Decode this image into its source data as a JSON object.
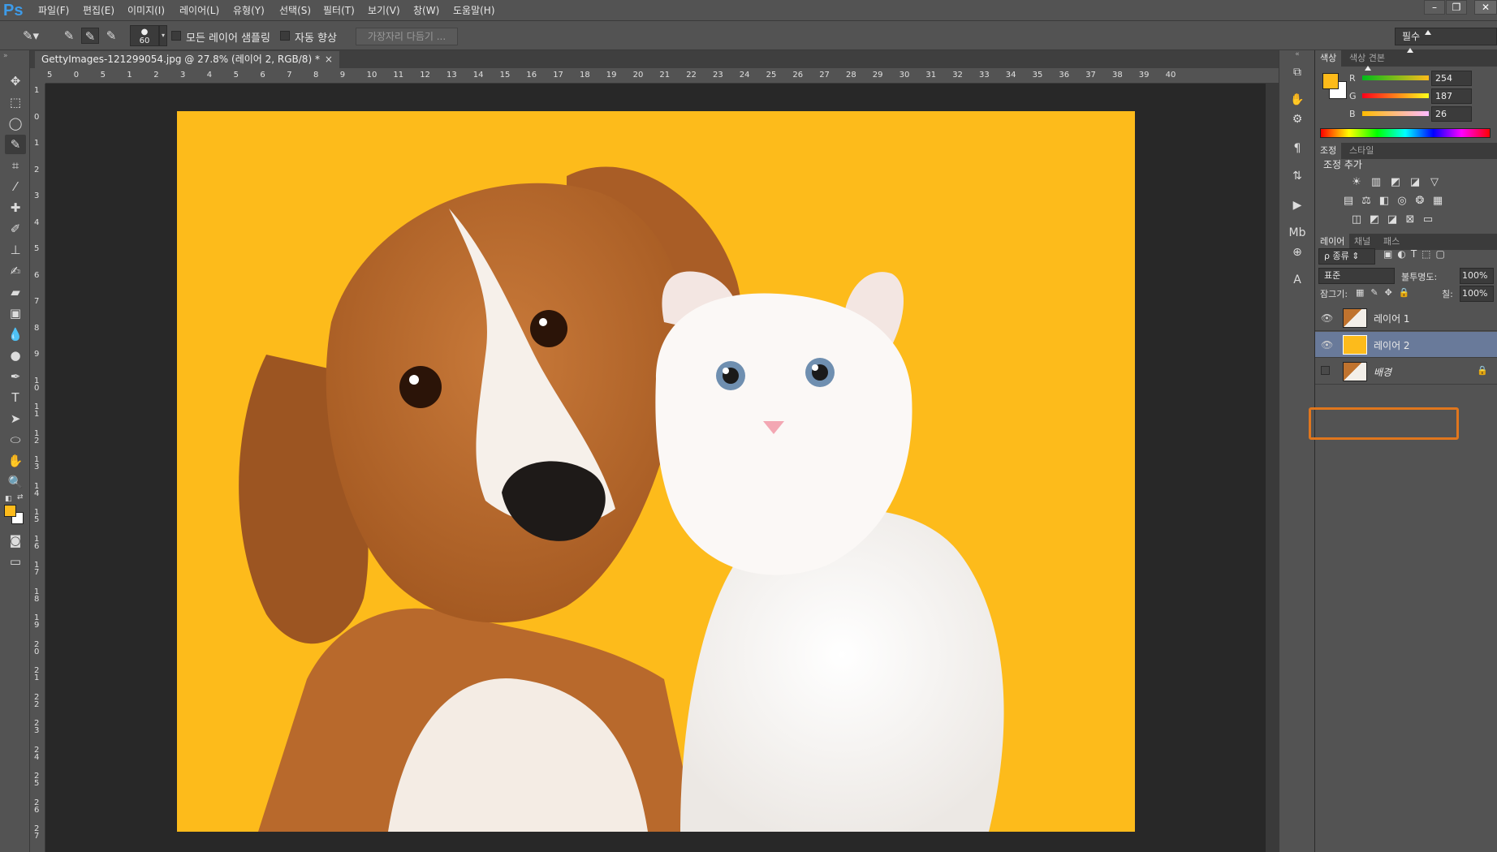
{
  "app": {
    "logo": "Ps"
  },
  "menu": [
    "파일(F)",
    "편집(E)",
    "이미지(I)",
    "레이어(L)",
    "유형(Y)",
    "선택(S)",
    "필터(T)",
    "보기(V)",
    "창(W)",
    "도움말(H)"
  ],
  "window_controls": {
    "minimize": "–",
    "restore": "❐",
    "close": "✕"
  },
  "options": {
    "brush_size": "60",
    "sample_all_layers": "모든 레이어 샘플링",
    "auto_enhance": "자동 향상",
    "refine_edge": "가장자리 다듬기 ...",
    "workspace": "필수"
  },
  "document": {
    "tab_title": "GettyImages-121299054.jpg @ 27.8% (레이어 2, RGB/8) *",
    "close": "×",
    "background_color": "#fdbb1b"
  },
  "ruler": {
    "h_labels": [
      "5",
      "0",
      "5",
      "1",
      "2",
      "3",
      "4",
      "5",
      "6",
      "7",
      "8",
      "9",
      "10",
      "11",
      "12",
      "13",
      "14",
      "15",
      "16",
      "17",
      "18",
      "19",
      "20",
      "21",
      "22",
      "23",
      "24",
      "25",
      "26",
      "27",
      "28",
      "29",
      "30",
      "31",
      "32",
      "33",
      "34",
      "35",
      "36",
      "37",
      "38",
      "39",
      "40"
    ],
    "v_labels": [
      "1",
      "0",
      "1",
      "2",
      "3",
      "4",
      "5",
      "6",
      "7",
      "8",
      "9",
      "1 0",
      "1 1",
      "1 2",
      "1 3",
      "1 4",
      "1 5",
      "1 6",
      "1 7",
      "1 8",
      "1 9",
      "2 0",
      "2 1",
      "2 2",
      "2 3",
      "2 4",
      "2 5",
      "2 6",
      "2 7"
    ]
  },
  "color_panel": {
    "tabs": [
      "색상",
      "색상 견본"
    ],
    "foreground": "#febb1a",
    "background": "#ffffff",
    "r_label": "R",
    "r_value": "254",
    "r": 254,
    "g_label": "G",
    "g_value": "187",
    "g": 187,
    "b_label": "B",
    "b_value": "26",
    "b": 26
  },
  "adjust_panel": {
    "tabs": [
      "조정",
      "스타일"
    ],
    "title": "조정 추가",
    "icons_row1": [
      "brightness-icon",
      "levels-icon",
      "curves-icon",
      "exposure-icon",
      "vibrance-icon"
    ],
    "icons_row2": [
      "hue-saturation-icon",
      "color-balance-icon",
      "black-white-icon",
      "photo-filter-icon",
      "channel-mixer-icon",
      "color-lookup-icon"
    ],
    "icons_row3": [
      "invert-icon",
      "posterize-icon",
      "threshold-icon",
      "selective-color-icon",
      "gradient-map-icon"
    ]
  },
  "layers_panel": {
    "tabs": [
      "레이어",
      "채널",
      "패스"
    ],
    "filter_kind": "ρ 종류",
    "blend_mode": "표준",
    "opacity_label": "불투명도:",
    "opacity": "100%",
    "lock_label": "잠그기:",
    "fill_label": "칠:",
    "fill": "100%",
    "layers": [
      {
        "name": "레이어 1",
        "visible": true,
        "selected": false
      },
      {
        "name": "레이어 2",
        "visible": true,
        "selected": true
      },
      {
        "name": "배경",
        "visible": false,
        "selected": false
      }
    ],
    "highlight_color": "#e0761d"
  }
}
